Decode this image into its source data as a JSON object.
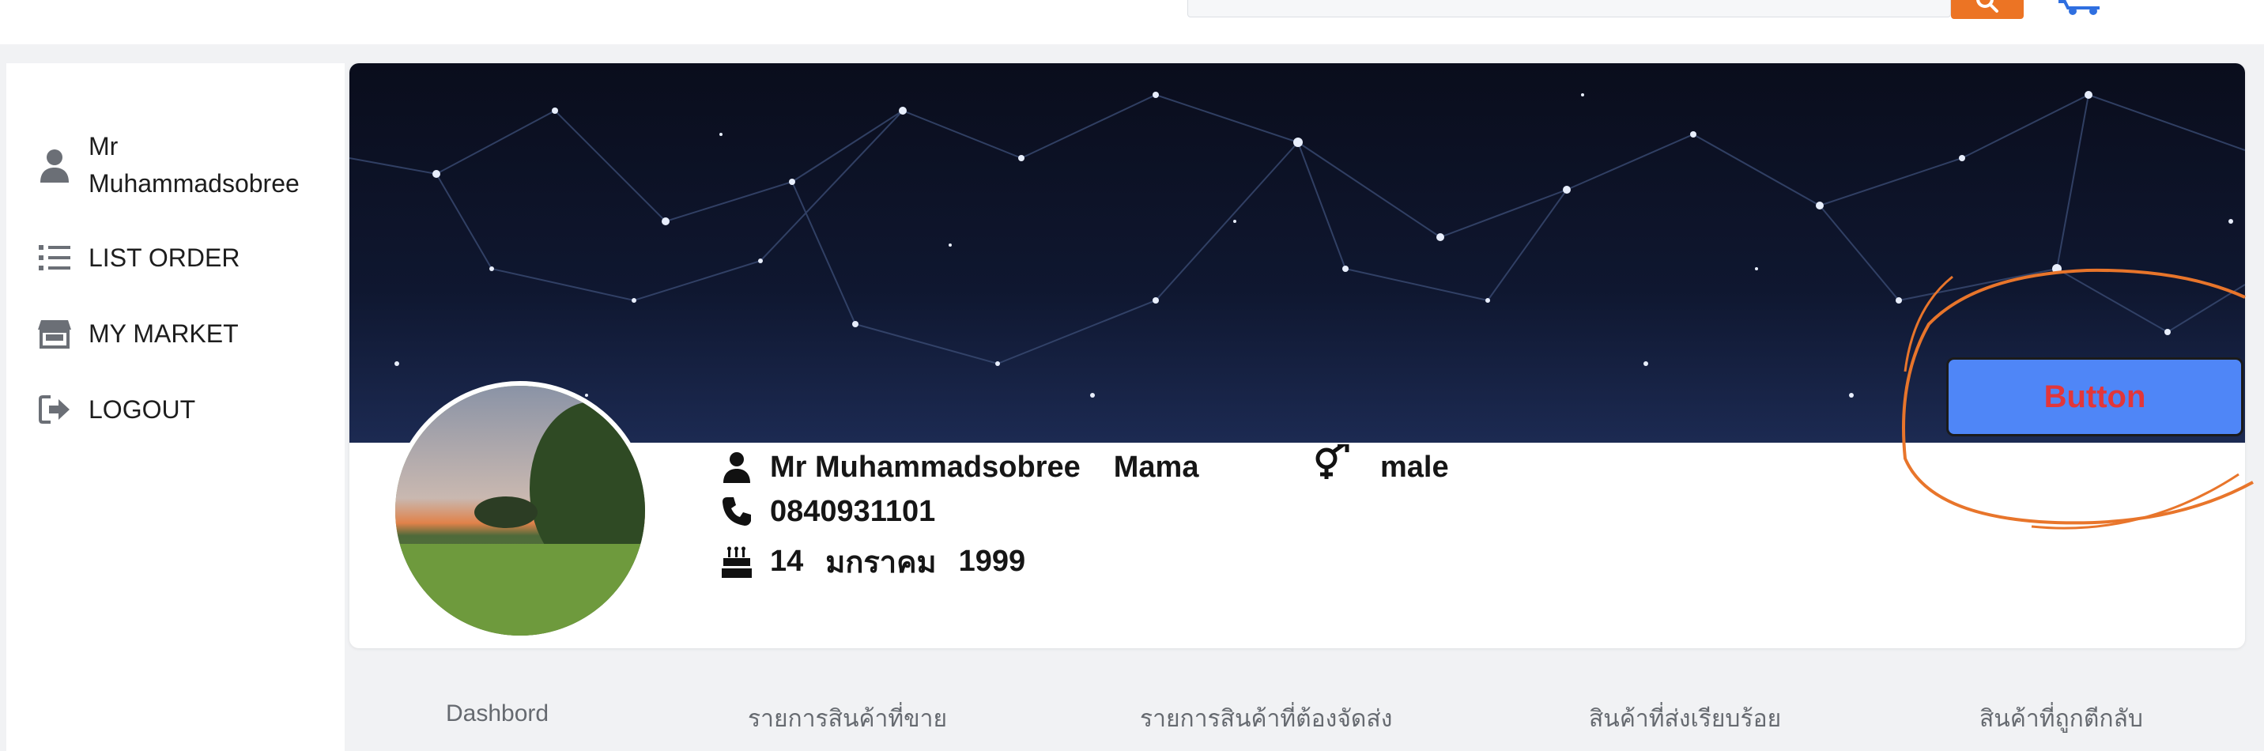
{
  "search": {
    "value": "",
    "placeholder": ""
  },
  "sidebar": {
    "user_line1": "Mr",
    "user_line2": "Muhammadsobree",
    "items": [
      {
        "label": "LIST ORDER",
        "icon": "list-icon"
      },
      {
        "label": "MY MARKET",
        "icon": "store-icon"
      },
      {
        "label": "LOGOUT",
        "icon": "logout-icon"
      }
    ]
  },
  "profile": {
    "first_name": "Mr Muhammadsobree",
    "last_name": "Mama",
    "gender": "male",
    "phone": "0840931101",
    "birth_day": "14",
    "birth_month": "มกราคม",
    "birth_year": "1999",
    "button_label": "Button"
  },
  "tabs": [
    "Dashbord",
    "รายการสินค้าที่ขาย",
    "รายการสินค้าที่ต้องจัดส่ง",
    "สินค้าที่ส่งเรียบร้อย",
    "สินค้าที่ถูกตีกลับ"
  ],
  "colors": {
    "accent_orange": "#ec7424",
    "button_blue": "#4f86f7",
    "button_text_red": "#e2363a",
    "cart_blue": "#2f6fe0",
    "annotation_orange": "#e8752b"
  }
}
